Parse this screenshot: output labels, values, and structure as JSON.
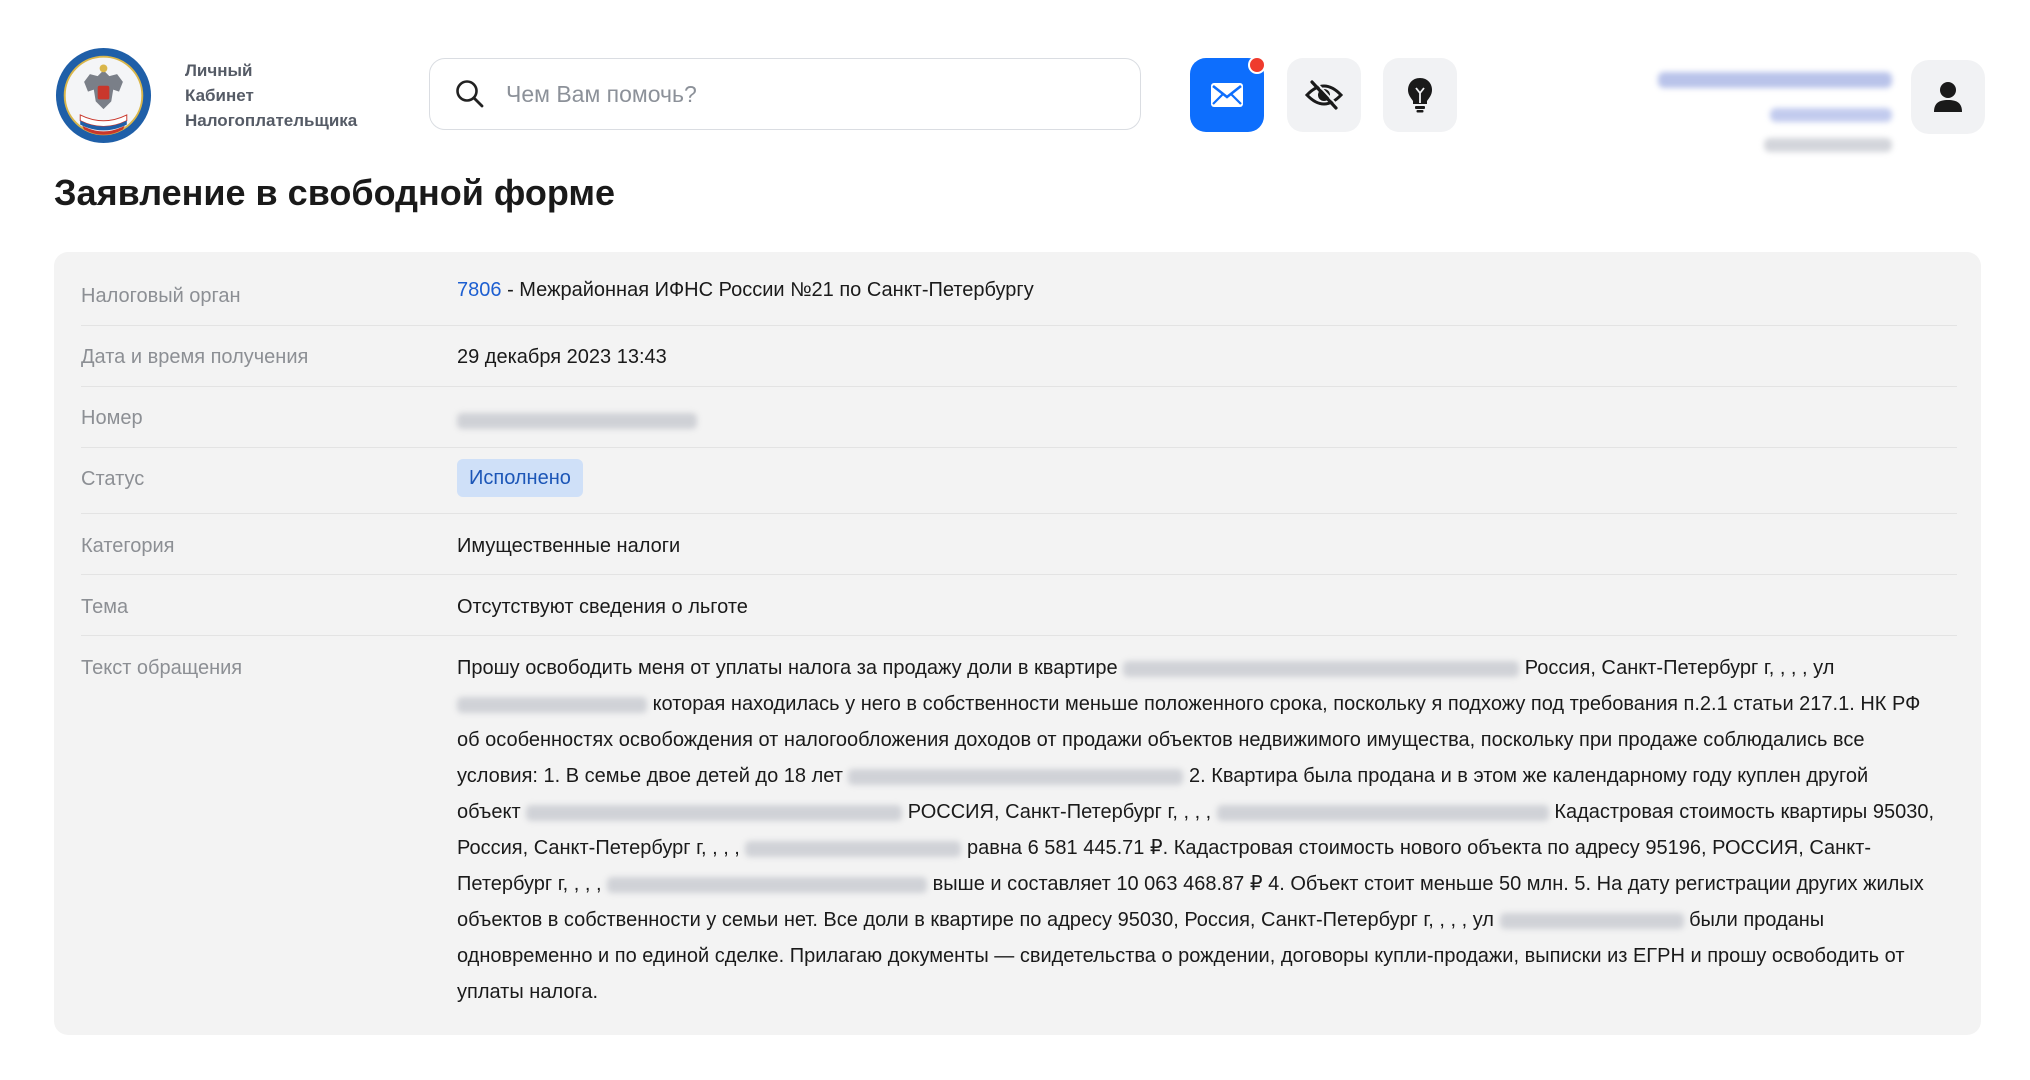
{
  "header": {
    "brand_line1": "Личный",
    "brand_line2": "Кабинет",
    "brand_line3": "Налогоплательщика",
    "search_placeholder": "Чем Вам помочь?",
    "icons": {
      "logo": "fns-emblem-logo",
      "search": "search-icon",
      "mail": "mail-icon",
      "eye": "eye-off-icon",
      "bulb": "lightbulb-icon",
      "user": "user-icon"
    },
    "colors": {
      "accent": "#0d6efd",
      "notification": "#ef3b2d"
    }
  },
  "page": {
    "title": "Заявление в свободной форме"
  },
  "details": {
    "tax_authority": {
      "label": "Налоговый орган",
      "code": "7806",
      "name": "- Межрайонная ИФНС России №21 по Санкт-Петербургу"
    },
    "received": {
      "label": "Дата и время получения",
      "value": "29 декабря 2023 13:43"
    },
    "number": {
      "label": "Номер"
    },
    "status": {
      "label": "Статус",
      "value": "Исполнено",
      "color": "#cfe0f8"
    },
    "category": {
      "label": "Категория",
      "value": "Имущественные налоги"
    },
    "subject": {
      "label": "Тема",
      "value": "Отсутствуют сведения о льготе"
    },
    "text": {
      "label": "Текст обращения",
      "p1": "Прошу освободить меня от уплаты налога за продажу доли в квартире",
      "p2": "Россия, Санкт-Петербург г, , , , ул",
      "p3": "которая находилась у него в собственности меньше положенного срока, поскольку я подхожу под требования п.2.1 статьи 217.1. НК РФ об особенностях освобождения от налогообложения доходов от продажи объектов недвижимого имущества, поскольку при продаже соблюдались все условия: 1. В семье двое детей до 18 лет",
      "p4": "2. Квартира была продана и в этом же календарному году куплен другой объект",
      "p5": "РОССИЯ, Санкт-Петербург г, , , ,",
      "p6": "Кадастровая стоимость квартиры 95030, Россия, Санкт-Петербург г, , , ,",
      "p7": "равна 6 581 445.71 ₽. Кадастровая стоимость нового объекта по адресу 95196, РОССИЯ, Санкт-Петербург г, , , ,",
      "p8": "выше и составляет 10 063 468.87 ₽ 4. Объект стоит меньше 50 млн. 5. На дату регистрации других жилых объектов в собственности у семьи нет. Все доли в квартире по адресу 95030, Россия, Санкт-Петербург г, , , , ул",
      "p9": "были проданы одновременно и по единой сделке. Прилагаю документы — свидетельства о рождении, договоры купли-продажи, выписки из ЕГРН и прошу освободить от уплаты налога."
    }
  }
}
